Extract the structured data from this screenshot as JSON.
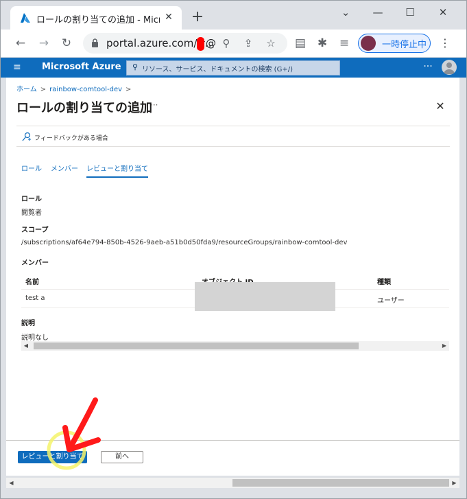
{
  "browser": {
    "tab_title": "ロールの割り当ての追加 - Microsoft",
    "tab_close": "✕",
    "new_tab": "+",
    "window_controls": {
      "minimize": "—",
      "maximize": "☐",
      "close": "✕",
      "tab_search": "⌄"
    },
    "nav": {
      "back": "←",
      "forward": "→",
      "reload": "↻"
    },
    "url": "portal.azure.com/#@",
    "url_ellipsis": "...",
    "profile_label": "一時停止中",
    "menu": "⋮",
    "icons": {
      "zoom": "⚲",
      "share": "⇪",
      "bookmark": "☆",
      "reading": "▤",
      "extensions": "✱",
      "media": "≡"
    }
  },
  "azure": {
    "brand": "Microsoft Azure",
    "menu_icon": "≡",
    "search_placeholder": "リソース、サービス、ドキュメントの検索 (G+/)",
    "search_icon": "⚲",
    "more": "···"
  },
  "blade": {
    "breadcrumb": [
      "ホーム",
      "rainbow-comtool-dev"
    ],
    "breadcrumb_sep": ">",
    "title": "ロールの割り当ての追加",
    "ellipsis": "···",
    "close": "✕",
    "feedback_label": "フィードバックがある場合",
    "tabs": [
      {
        "label": "ロール",
        "active": false
      },
      {
        "label": "メンバー",
        "active": false
      },
      {
        "label": "レビューと割り当て",
        "active": true
      }
    ],
    "role_label": "ロール",
    "role_value": "閲覧者",
    "scope_label": "スコープ",
    "scope_value": "/subscriptions/af64e794-850b-4526-9aeb-a51b0d50fda9/resourceGroups/rainbow-comtool-dev",
    "members_label": "メンバー",
    "columns": [
      "名前",
      "オブジェクト ID",
      "種類"
    ],
    "rows": [
      {
        "name": "test a",
        "object_id": "",
        "type": "ユーザー"
      }
    ],
    "description_label": "説明",
    "description_value": "説明なし",
    "scroll_left": "◀",
    "scroll_right": "▶"
  },
  "footer": {
    "primary_button": "レビューと割り当て",
    "back_button": "前へ"
  },
  "colors": {
    "azure_blue": "#0f6cbd",
    "annotation_arrow": "#ff1a1a",
    "annotation_circle": "#f5f36a"
  }
}
